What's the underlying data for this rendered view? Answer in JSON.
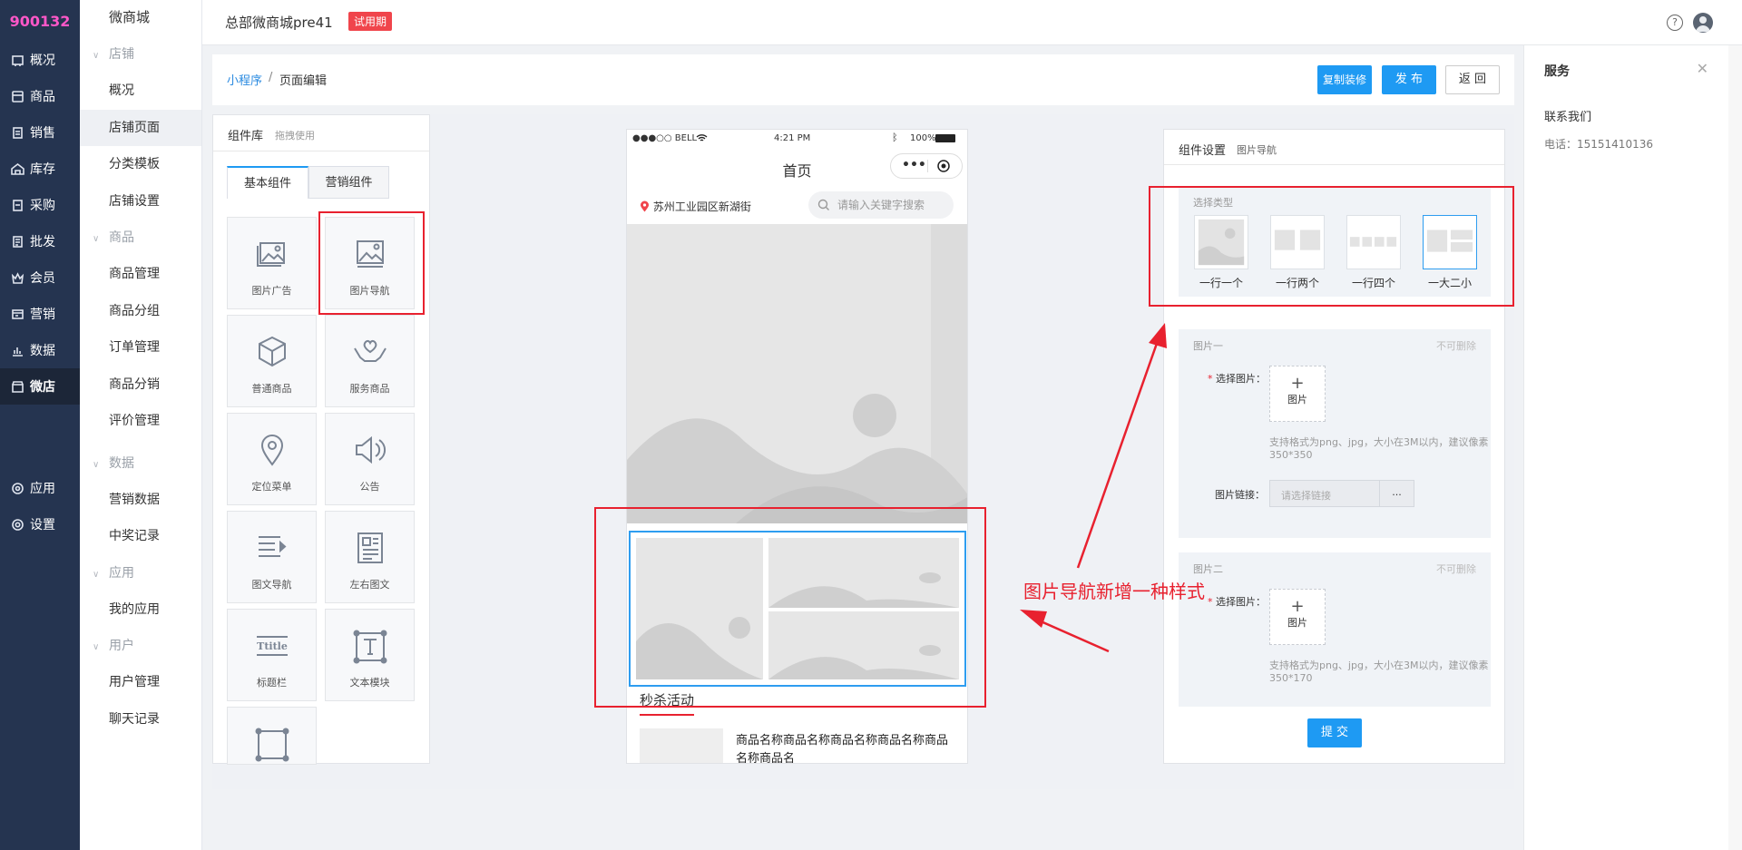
{
  "nav": {
    "brand": "900132",
    "items": [
      {
        "label": "概况",
        "icon": "dashboard-icon"
      },
      {
        "label": "商品",
        "icon": "goods-icon"
      },
      {
        "label": "销售",
        "icon": "sales-icon"
      },
      {
        "label": "库存",
        "icon": "inventory-icon"
      },
      {
        "label": "采购",
        "icon": "purchase-icon"
      },
      {
        "label": "批发",
        "icon": "wholesale-icon"
      },
      {
        "label": "会员",
        "icon": "member-icon"
      },
      {
        "label": "营销",
        "icon": "marketing-icon"
      },
      {
        "label": "数据",
        "icon": "data-icon"
      },
      {
        "label": "微店",
        "icon": "shop-icon"
      },
      {
        "label": "应用",
        "icon": "app-icon"
      },
      {
        "label": "设置",
        "icon": "settings-icon"
      }
    ]
  },
  "subnav": {
    "top": "微商城",
    "groups": [
      {
        "title": "店铺",
        "items": [
          "概况",
          "店铺页面",
          "分类模板",
          "店铺设置"
        ]
      },
      {
        "title": "商品",
        "items": [
          "商品管理",
          "商品分组",
          "订单管理",
          "商品分销",
          "评价管理"
        ]
      },
      {
        "title": "数据",
        "items": [
          "营销数据",
          "中奖记录"
        ]
      },
      {
        "title": "应用",
        "items": [
          "我的应用"
        ]
      },
      {
        "title": "用户",
        "items": [
          "用户管理",
          "聊天记录"
        ]
      }
    ]
  },
  "header": {
    "shop_name": "总部微商城pre41",
    "trial_badge": "试用期",
    "help": "?"
  },
  "breadcrumb": {
    "parent": "小程序",
    "sep": "/",
    "current": "页面编辑"
  },
  "actions": {
    "copy": "复制装修",
    "publish": "发 布",
    "back": "返 回"
  },
  "library": {
    "title": "组件库",
    "hint": "拖拽使用",
    "tabs": [
      "基本组件",
      "营销组件"
    ],
    "components": [
      {
        "label": "图片广告",
        "icon": "image-ad-icon"
      },
      {
        "label": "图片导航",
        "icon": "image-nav-icon"
      },
      {
        "label": "普通商品",
        "icon": "box-icon"
      },
      {
        "label": "服务商品",
        "icon": "service-hands-icon"
      },
      {
        "label": "定位菜单",
        "icon": "location-pin-icon"
      },
      {
        "label": "公告",
        "icon": "speaker-icon"
      },
      {
        "label": "图文导航",
        "icon": "text-nav-icon"
      },
      {
        "label": "左右图文",
        "icon": "document-icon"
      },
      {
        "label": "标题栏",
        "icon": "title-bar-icon"
      },
      {
        "label": "文本模块",
        "icon": "text-module-icon"
      }
    ],
    "title_icon_text": "Ttitle"
  },
  "phone": {
    "carrier": "●●●○○ BELL",
    "time": "4:21 PM",
    "battery": "100%",
    "title": "首页",
    "location": "苏州工业园区新湖街",
    "search_placeholder": "请输入关键字搜索",
    "section_title": "秒杀活动",
    "goods_name": "商品名称商品名称商品名称商品名称商品名称商品名"
  },
  "settings": {
    "title": "组件设置",
    "subtitle": "图片导航",
    "type_label": "选择类型",
    "types": [
      "一行一个",
      "一行两个",
      "一行四个",
      "一大二小"
    ],
    "selected_type": 3,
    "image1": {
      "title": "图片一",
      "undeletable": "不可删除",
      "select_label": "选择图片：",
      "upload": "图片",
      "hint": "支持格式为png、jpg，大小在3M以内，建议像素",
      "size": "350*350",
      "link_label": "图片链接：",
      "link_placeholder": "请选择链接",
      "link_btn": "..."
    },
    "image2": {
      "title": "图片二",
      "undeletable": "不可删除",
      "select_label": "选择图片：",
      "upload": "图片",
      "hint": "支持格式为png、jpg，大小在3M以内，建议像素",
      "size": "350*170"
    },
    "submit": "提 交"
  },
  "service": {
    "title": "服务",
    "contact": "联系我们",
    "phone": "电话：15151410136"
  },
  "annotation": {
    "text": "图片导航新增一种样式"
  },
  "colors": {
    "accent": "#1e9af3",
    "nav_bg": "#253450",
    "brand": "#ff57c8",
    "annotation": "#e8212f"
  }
}
